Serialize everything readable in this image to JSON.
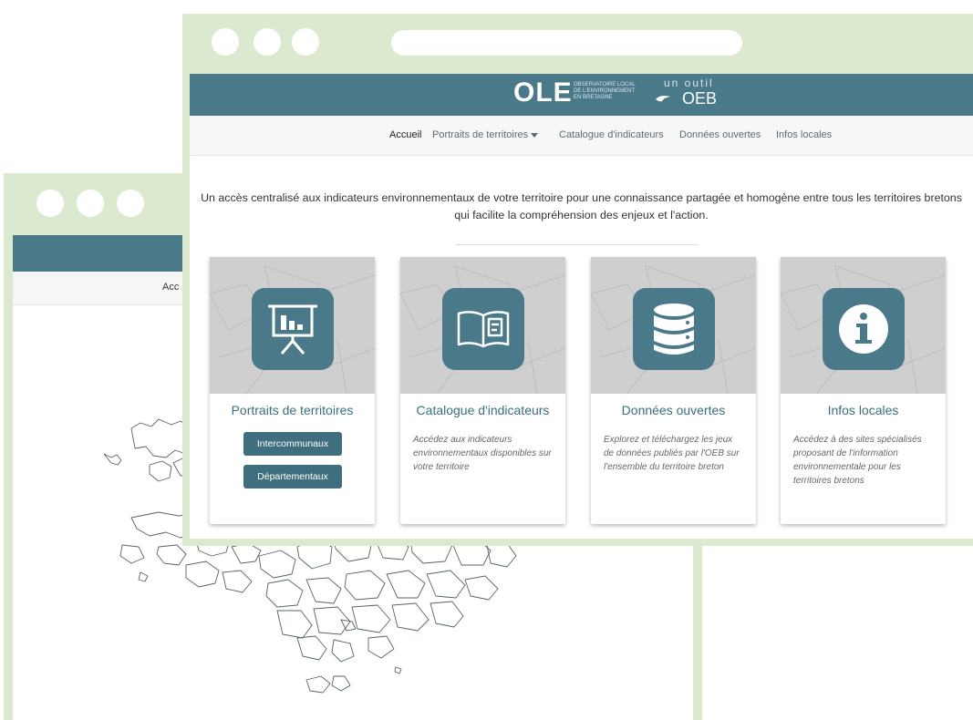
{
  "back_window": {
    "nav_fragment": "Acc"
  },
  "header": {
    "logo_main": "OLE",
    "logo_sub_lines": [
      "OBSERVATOIRE LOCAL",
      "DE L'ENVIRONNEMENT",
      "EN BRETAGNE"
    ],
    "logo_tool": "un outil",
    "logo_oeb": "OEB"
  },
  "nav": {
    "items": [
      "Accueil",
      "Portraits de territoires",
      "Catalogue d'indicateurs",
      "Données ouvertes",
      "Infos locales"
    ]
  },
  "intro": {
    "text": "Un accès centralisé aux indicateurs environnementaux de votre territoire pour une connaissance partagée et homogène entre tous les territoires bretons qui facilite la compréhension des enjeux et l'action."
  },
  "cards": [
    {
      "title": "Portraits de territoires",
      "icon": "presentation-chart-icon",
      "buttons": [
        "Intercommunaux",
        "Départementaux"
      ]
    },
    {
      "title": "Catalogue d'indicateurs",
      "icon": "open-book-icon",
      "description": "Accédez aux indicateurs environnementaux disponibles sur votre territoire"
    },
    {
      "title": "Données ouvertes",
      "icon": "database-icon",
      "description": "Explorez et téléchargez les jeux de données publiés par l'OEB sur l'ensemble du territoire breton"
    },
    {
      "title": "Infos locales",
      "icon": "info-icon",
      "description": "Accédez à des sites spécialisés proposant de l'information environnementale pour les territoires bretons"
    }
  ],
  "colors": {
    "frame": "#dbe9cf",
    "brand": "#4a7a8a",
    "button": "#3f6f7e"
  }
}
